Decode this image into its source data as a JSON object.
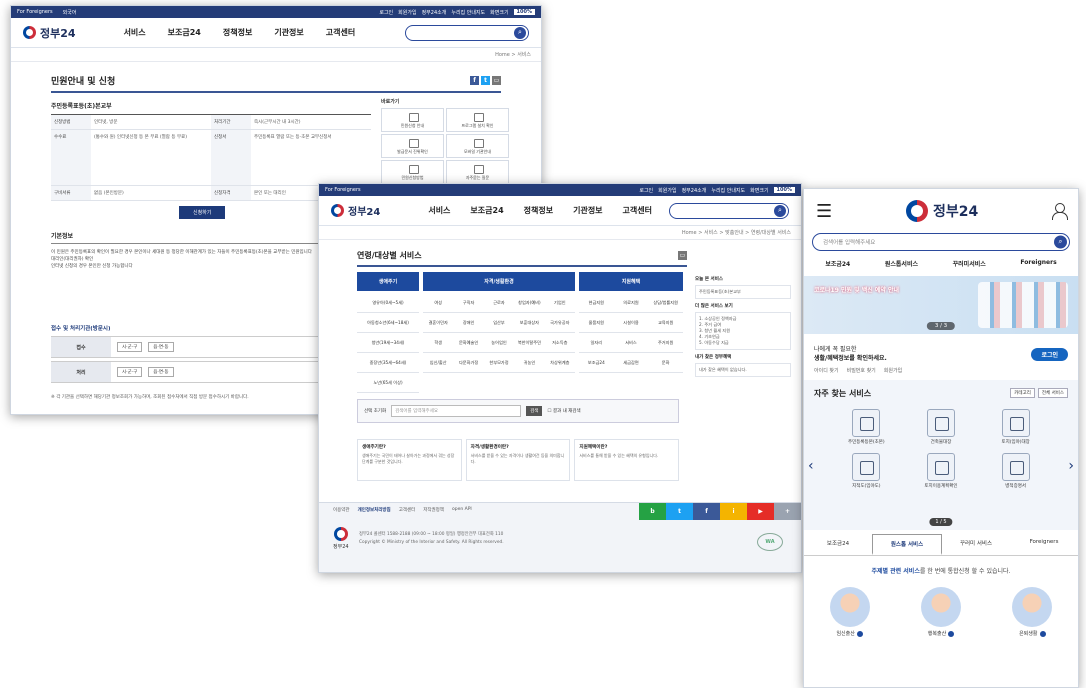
{
  "common": {
    "brand": "정부24",
    "foreigners": "For Foreigners",
    "lang_select": "외국어",
    "top_links": [
      "로그인",
      "회원가입",
      "정부24소개",
      "누리집 안내지도",
      "화면크기"
    ],
    "zoom": "100%",
    "menu": [
      "서비스",
      "보조금24",
      "정책정보",
      "기관정보",
      "고객센터"
    ],
    "search_icon": "search-icon"
  },
  "shot1": {
    "breadcrumb": "Home > 서비스",
    "title": "민원안내 및 신청",
    "sub_title": "주민등록표등(초)본교부",
    "table": [
      {
        "th": "신청방법",
        "td": "인터넷, 방문",
        "th2": "처리기간",
        "td2": "즉시(근무시간 내 3시간)"
      },
      {
        "th": "수수료",
        "td": "(통수와 원) 인터넷신청 등 본 무료 (열람 등 무료)",
        "th2": "신청서",
        "td2": "주민등록표 열람 또는 등·초본 교부신청서"
      },
      {
        "th": "구비서류",
        "td": "없음 (본인방문)",
        "th2": "신청자격",
        "td2": "본인 또는 대리인"
      }
    ],
    "shortcut_title": "바로가기",
    "shortcuts": [
      "민원신청 안내",
      "프로그램 설치 확인",
      "발급문서 진위확인",
      "모바일 기관안내",
      "민원신청방법",
      "자주묻는 질문"
    ],
    "apply_button": "신청하기",
    "basic_title": "기본정보",
    "basic_lines": [
      "이 민원은 주민등록표의 확인이 필요한 경우 본인이나 세대원 등 정당한 이해관계가 있는 자들이 주민등록표등(초)본을 교부받는 민원입니다",
      "대리인(대리권자) 확인",
      "인터넷 신청의 경우 본인만 신청 가능합니다"
    ],
    "receive_title": "접수 및 처리기관(방문시)",
    "receive_rows": [
      {
        "label": "접수",
        "chips": [
          "시·군·구",
          "읍·면·동"
        ]
      },
      {
        "label": "처리",
        "chips": [
          "시·군·구",
          "읍·면·동"
        ]
      }
    ],
    "note": "※ 각 기관을 선택하면 해당기관 정보조회가 가능하며, 조회된 접수처에서 직접 방문 접수하시기 바랍니다."
  },
  "shot2": {
    "breadcrumb": "Home > 서비스 > 맞춤안내 > 연령/대상별 서비스",
    "title": "연령/대상별 서비스",
    "columns": [
      {
        "head": "생애주기",
        "items": [
          "영유아(0세~5세)",
          "아동청소년(6세~18세)",
          "청년(19세~34세)",
          "중장년(35세~64세)",
          "노년(65세 이상)"
        ]
      },
      {
        "head": "자격/생활환경",
        "items": [
          "여성",
          "구직자",
          "근로자",
          "창업자(예비)",
          "기업인",
          "결혼이민자",
          "장애인",
          "임산부",
          "보훈대상자",
          "국가유공자",
          "학생",
          "문화예술인",
          "농어업인",
          "북한이탈주민",
          "저소득층",
          "임신/출산",
          "다문화가정",
          "한부모가정",
          "귀농인",
          "차상위계층"
        ]
      },
      {
        "head": "지원혜택",
        "items": [
          "현금지원",
          "의료지원",
          "상담/법률지원",
          "물품지원",
          "시설이용",
          "교육지원",
          "일자리",
          "서비스",
          "주거지원",
          "보조금24",
          "세금감면",
          "문화",
          "기타"
        ]
      }
    ],
    "search_reset": "선택 초기화",
    "search_placeholder": "검색어를 입력해주세요",
    "search_button": "검색",
    "search_check": "결과 내 재검색",
    "cards": [
      {
        "title": "생애주기란?",
        "desc": "생애주기는 국민이 태어나 살아가는 과정에서 겪는 성장단계를 구분한 것입니다."
      },
      {
        "title": "자격/생활환경이란?",
        "desc": "서비스를 받을 수 있는 자격이나 생활여건 등을 의미합니다."
      },
      {
        "title": "지원혜택이란?",
        "desc": "서비스를 통해 받을 수 있는 혜택의 유형입니다."
      }
    ],
    "right_title1": "오늘 본 서비스",
    "right_item1": "주민등록표등(초)본교부",
    "right_title2": "더 많은 서비스 보기",
    "right_items2": [
      "1. 소상공인 정책자금",
      "2. 주거 급여",
      "3. 청년 월세 지원",
      "4. 기초연금",
      "5. 아동수당 지급"
    ],
    "right_title3": "내가 찾은 정부혜택",
    "right_item3": "내가 찾은 혜택이 없습니다.",
    "footer_links": [
      "이용약관",
      "개인정보처리방침",
      "고객센터",
      "저작권정책",
      "open API"
    ],
    "footer_info1": "정부24 콜센터 1588-2188 (09:00 ~ 18:00 평일) 행정안전부 대표전화 110",
    "footer_info2": "Copyright © Ministry of the Interior and Safety. All Rights reserved.",
    "footer_sns": [
      "b",
      "t",
      "f",
      "i",
      "▶",
      "+"
    ],
    "wa_mark": "WA"
  },
  "shot3": {
    "search_placeholder": "검색어를 입력해주세요",
    "tabs": [
      "보조금24",
      "원스톱서비스",
      "꾸러미서비스",
      "Foreigners"
    ],
    "banner_text": "코로나19 민원 및 백신 예약 안내",
    "banner_page": "3 / 3",
    "login_line1": "나에게 꼭 필요한",
    "login_line2": "생활/혜택정보를 확인하세요.",
    "login_button": "로그인",
    "login_links": [
      "아이디 찾기",
      "비밀번호 찾기",
      "회원가입"
    ],
    "freq_title": "자주 찾는 서비스",
    "freq_selects": [
      "카테고리",
      "전체 서비스"
    ],
    "services": [
      "주민등록등본(초본)",
      "건축물대장",
      "토지(임야)대장",
      "지적도(임야도)",
      "토지이용계획확인",
      "병적증명서"
    ],
    "freq_page": "1 / 5",
    "tabs2": [
      "보조금24",
      "원스톱 서비스",
      "꾸러미 서비스",
      "Foreigners"
    ],
    "life_text_pre": "주제별 관련 서비스",
    "life_text_post": "를 한 번에 통합신청 할 수 있습니다.",
    "people": [
      "임신출산",
      "행복출산",
      "은퇴생활"
    ]
  },
  "colors": {
    "navy": "#243c78",
    "blue": "#1d4a9e",
    "red": "#cd2e3a"
  }
}
